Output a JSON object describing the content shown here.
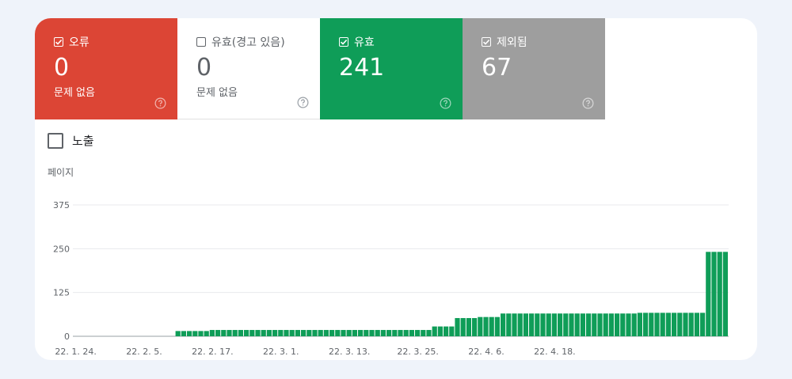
{
  "tiles": [
    {
      "key": "error",
      "label": "오류",
      "value": "0",
      "sub": "문제 없음",
      "checked": true
    },
    {
      "key": "warning",
      "label": "유효(경고 있음)",
      "value": "0",
      "sub": "문제 없음",
      "checked": false
    },
    {
      "key": "valid",
      "label": "유효",
      "value": "241",
      "sub": "",
      "checked": true
    },
    {
      "key": "excluded",
      "label": "제외됨",
      "value": "67",
      "sub": "",
      "checked": true
    }
  ],
  "impressions": {
    "label": "노출",
    "checked": false
  },
  "colors": {
    "error": "#dc4535",
    "valid": "#0f9d58",
    "excluded": "#9e9e9e",
    "excluded_bar": "#bdbdbd",
    "valid_bar": "#0f9d58"
  },
  "chart_data": {
    "type": "bar",
    "stacked": true,
    "ylabel": "페이지",
    "yticks": [
      0,
      125,
      250,
      375
    ],
    "ylim": [
      0,
      375
    ],
    "grid": true,
    "xtick_labels": [
      {
        "index": 0,
        "label": "22. 1. 24."
      },
      {
        "index": 12,
        "label": "22. 2. 5."
      },
      {
        "index": 24,
        "label": "22. 2. 17."
      },
      {
        "index": 36,
        "label": "22. 3. 1."
      },
      {
        "index": 48,
        "label": "22. 3. 13."
      },
      {
        "index": 60,
        "label": "22. 3. 25."
      },
      {
        "index": 72,
        "label": "22. 4. 6."
      },
      {
        "index": 84,
        "label": "22. 4. 18."
      }
    ],
    "series": [
      {
        "key": "valid",
        "values": [
          0,
          0,
          0,
          0,
          0,
          0,
          0,
          0,
          0,
          0,
          0,
          0,
          0,
          0,
          0,
          0,
          0,
          0,
          15,
          15,
          15,
          15,
          15,
          15,
          18,
          18,
          18,
          18,
          18,
          18,
          18,
          18,
          18,
          18,
          18,
          18,
          18,
          18,
          18,
          18,
          18,
          18,
          18,
          18,
          18,
          18,
          18,
          18,
          18,
          18,
          18,
          18,
          18,
          18,
          18,
          18,
          18,
          18,
          18,
          18,
          18,
          18,
          18,
          28,
          28,
          28,
          28,
          52,
          52,
          52,
          52,
          55,
          55,
          55,
          55,
          65,
          65,
          65,
          65,
          65,
          65,
          65,
          65,
          65,
          65,
          65,
          65,
          65,
          65,
          65,
          65,
          65,
          65,
          65,
          65,
          65,
          65,
          65,
          65,
          67,
          67,
          67,
          67,
          67,
          67,
          67,
          67,
          67,
          67,
          67,
          67,
          241,
          241,
          241,
          241
        ]
      },
      {
        "key": "excluded",
        "values": [
          0,
          0,
          0,
          0,
          0,
          0,
          0,
          0,
          0,
          0,
          0,
          0,
          0,
          0,
          0,
          0,
          0,
          0,
          0,
          0,
          0,
          0,
          0,
          0,
          0,
          0,
          0,
          0,
          0,
          0,
          0,
          0,
          0,
          0,
          0,
          0,
          0,
          0,
          0,
          0,
          0,
          0,
          0,
          0,
          0,
          0,
          0,
          0,
          0,
          0,
          0,
          0,
          0,
          0,
          0,
          0,
          0,
          0,
          0,
          0,
          0,
          0,
          0,
          0,
          0,
          0,
          0,
          0,
          0,
          0,
          0,
          0,
          0,
          0,
          0,
          0,
          0,
          0,
          0,
          0,
          0,
          0,
          0,
          0,
          0,
          0,
          0,
          0,
          0,
          0,
          0,
          0,
          0,
          0,
          0,
          0,
          0,
          0,
          0,
          0,
          0,
          0,
          0,
          0,
          0,
          0,
          0,
          0,
          0,
          0,
          0,
          0,
          0,
          0,
          0
        ]
      }
    ]
  }
}
